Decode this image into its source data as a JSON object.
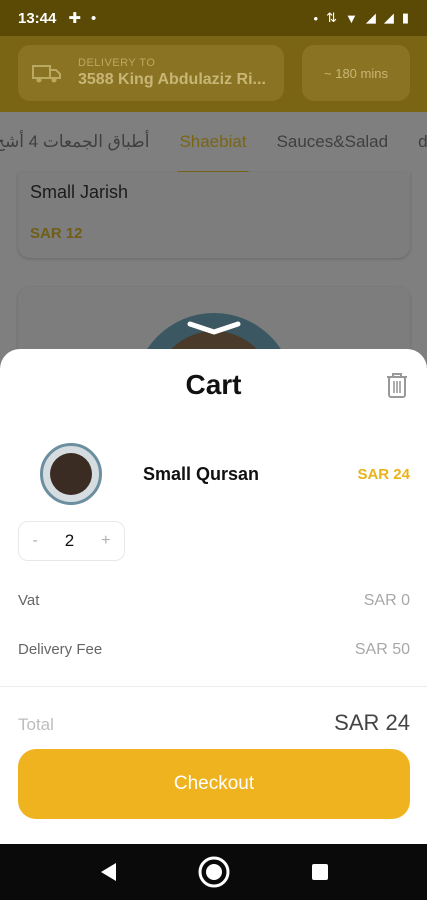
{
  "status_bar": {
    "time": "13:44"
  },
  "header": {
    "delivery_label": "DELIVERY TO",
    "delivery_address": "3588 King Abdulaziz Ri...",
    "eta": "~ 180 mins"
  },
  "tabs": [
    {
      "label": "أطباق الجمعات 4 أشخ"
    },
    {
      "label": "Shaebiat"
    },
    {
      "label": "Sauces&Salad"
    },
    {
      "label": "de"
    }
  ],
  "background_list": {
    "item_name": "Small Jarish",
    "item_price": "SAR 12"
  },
  "cart": {
    "title": "Cart",
    "item": {
      "name": "Small Qursan",
      "price": "SAR 24",
      "quantity": "2",
      "minus": "-",
      "plus": "+"
    },
    "vat": {
      "label": "Vat",
      "value": "SAR 0"
    },
    "delivery_fee": {
      "label": "Delivery Fee",
      "value": "SAR 50"
    },
    "total": {
      "label": "Total",
      "value": "SAR 24"
    },
    "checkout_label": "Checkout"
  },
  "colors": {
    "accent": "#efb320",
    "price": "#e9b21c",
    "header_dim": "#7a6515"
  }
}
